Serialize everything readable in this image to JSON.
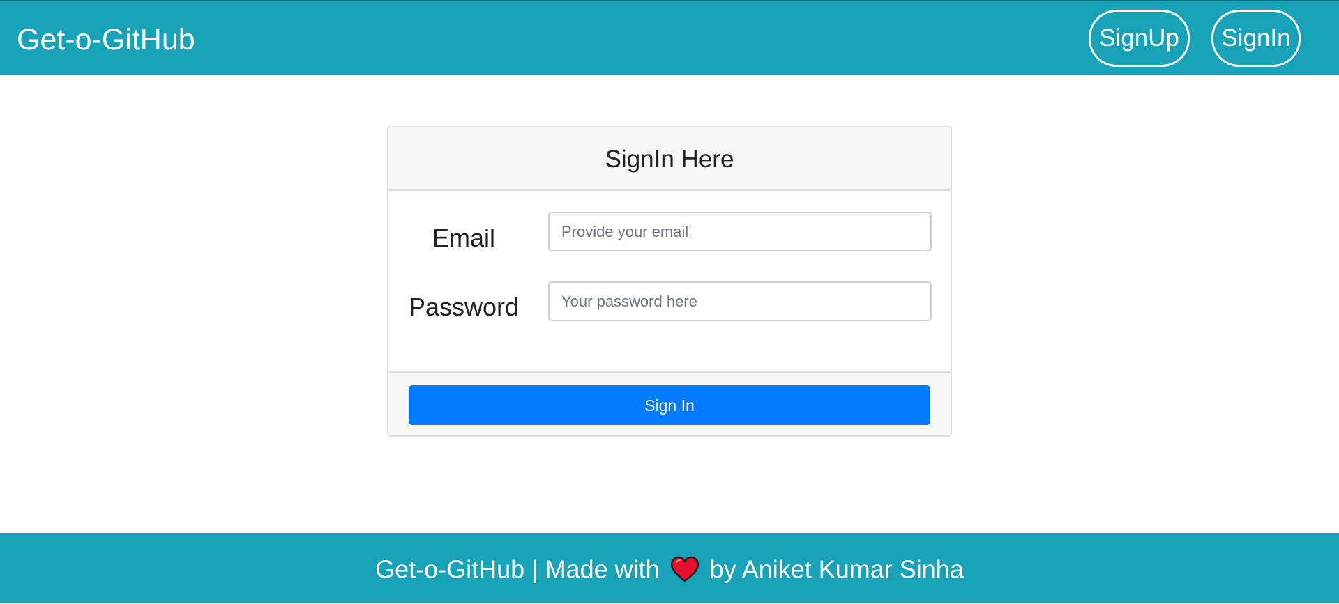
{
  "navbar": {
    "brand": "Get-o-GitHub",
    "signup_label": "SignUp",
    "signin_label": "SignIn"
  },
  "card": {
    "title": "SignIn Here",
    "email": {
      "label": "Email",
      "value": "",
      "placeholder": "Provide your email"
    },
    "password": {
      "label": "Password",
      "value": "",
      "placeholder": "Your password here"
    },
    "submit_label": "Sign In"
  },
  "footer": {
    "prefix": "Get-o-GitHub | Made with",
    "icon": "heart-icon",
    "suffix": "by Aniket Kumar Sinha"
  },
  "colors": {
    "primary_bar": "#17a2b8",
    "button_primary": "#007bff",
    "heart": "#e8112d"
  }
}
